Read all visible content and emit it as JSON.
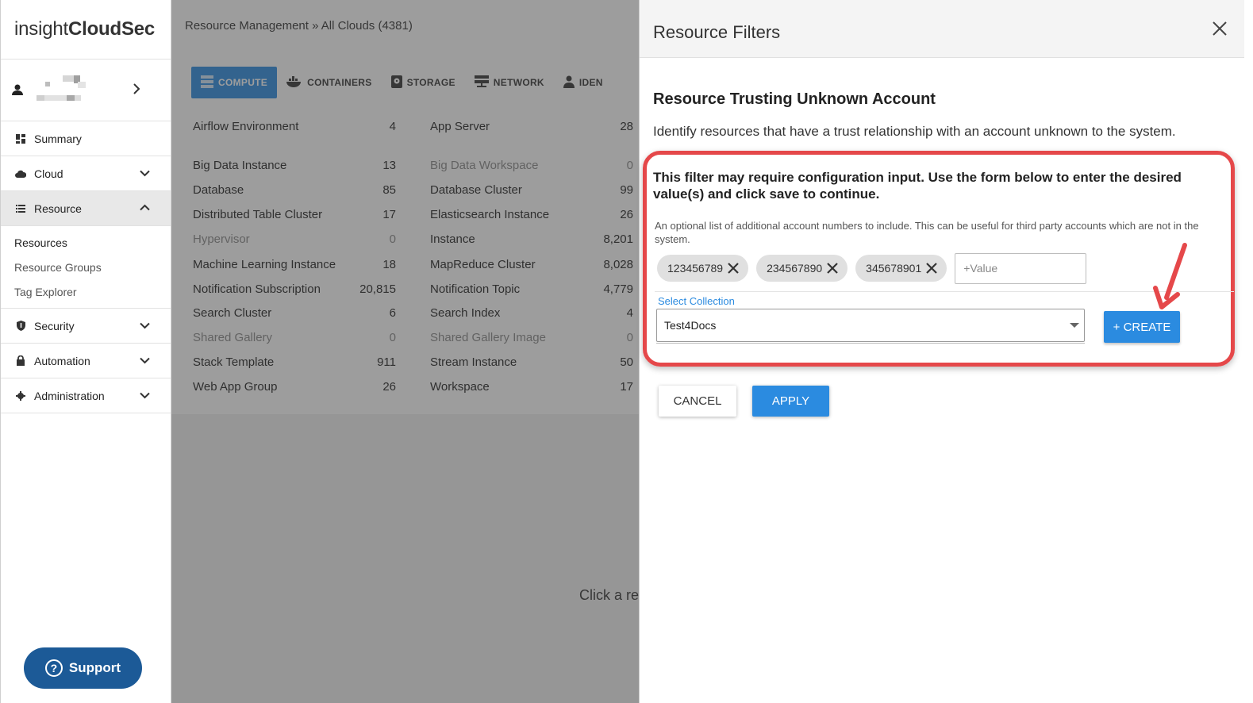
{
  "app": {
    "logo_light": "insight",
    "logo_bold": "CloudSec"
  },
  "sidebar": {
    "nav": [
      {
        "label": "Summary",
        "icon": "dashboard-icon"
      },
      {
        "label": "Cloud",
        "icon": "cloud-icon"
      },
      {
        "label": "Resource",
        "icon": "list-icon"
      },
      {
        "label": "Security",
        "icon": "shield-icon"
      },
      {
        "label": "Automation",
        "icon": "lock-icon"
      },
      {
        "label": "Administration",
        "icon": "gear-icon"
      }
    ],
    "resource_sub": [
      "Resources",
      "Resource Groups",
      "Tag Explorer"
    ],
    "support_label": "Support"
  },
  "main": {
    "breadcrumb": "Resource Management » All Clouds (4381)",
    "tabs": [
      {
        "label": "COMPUTE",
        "icon": "server-icon"
      },
      {
        "label": "CONTAINERS",
        "icon": "docker-icon"
      },
      {
        "label": "STORAGE",
        "icon": "storage-icon"
      },
      {
        "label": "NETWORK",
        "icon": "network-icon"
      },
      {
        "label": "IDEN",
        "icon": "person-icon"
      }
    ],
    "left_column": [
      {
        "label": "Airflow Environment",
        "count": "4"
      },
      {
        "label": "Big Data Instance",
        "count": "13"
      },
      {
        "label": "Database",
        "count": "85"
      },
      {
        "label": "Distributed Table Cluster",
        "count": "17"
      },
      {
        "label": "Hypervisor",
        "count": "0"
      },
      {
        "label": "Machine Learning Instance",
        "count": "18"
      },
      {
        "label": "Notification Subscription",
        "count": "20,815"
      },
      {
        "label": "Search Cluster",
        "count": "6"
      },
      {
        "label": "Shared Gallery",
        "count": "0"
      },
      {
        "label": "Stack Template",
        "count": "911"
      },
      {
        "label": "Web App Group",
        "count": "26"
      }
    ],
    "right_column": [
      {
        "label": "App Server",
        "count": "28"
      },
      {
        "label": "Big Data Workspace",
        "count": "0"
      },
      {
        "label": "Database Cluster",
        "count": "99"
      },
      {
        "label": "Elasticsearch Instance",
        "count": "26"
      },
      {
        "label": "Instance",
        "count": "8,201"
      },
      {
        "label": "MapReduce Cluster",
        "count": "8,028"
      },
      {
        "label": "Notification Topic",
        "count": "4,779"
      },
      {
        "label": "Search Index",
        "count": "4"
      },
      {
        "label": "Shared Gallery Image",
        "count": "0"
      },
      {
        "label": "Stream Instance",
        "count": "50"
      },
      {
        "label": "Workspace",
        "count": "17"
      }
    ],
    "hint": "Click a res"
  },
  "panel": {
    "title": "Resource Filters",
    "filter_title": "Resource Trusting Unknown Account",
    "filter_desc": "Identify resources that have a trust relationship with an account unknown to the system.",
    "config_note": "This filter may require configuration input. Use the form below to enter the desired value(s) and click save to continue.",
    "optional_desc": "An optional list of additional account numbers to include. This can be useful for third party accounts which are not in the system.",
    "chips": [
      "123456789",
      "234567890",
      "345678901"
    ],
    "value_placeholder": "+Value",
    "collection_label": "Select Collection",
    "collection_value": "Test4Docs",
    "create_label": "+ CREATE",
    "cancel_label": "CANCEL",
    "apply_label": "APPLY"
  },
  "colors": {
    "accent": "#2b8be0",
    "highlight": "#e5484a",
    "support": "#1c5a97"
  }
}
